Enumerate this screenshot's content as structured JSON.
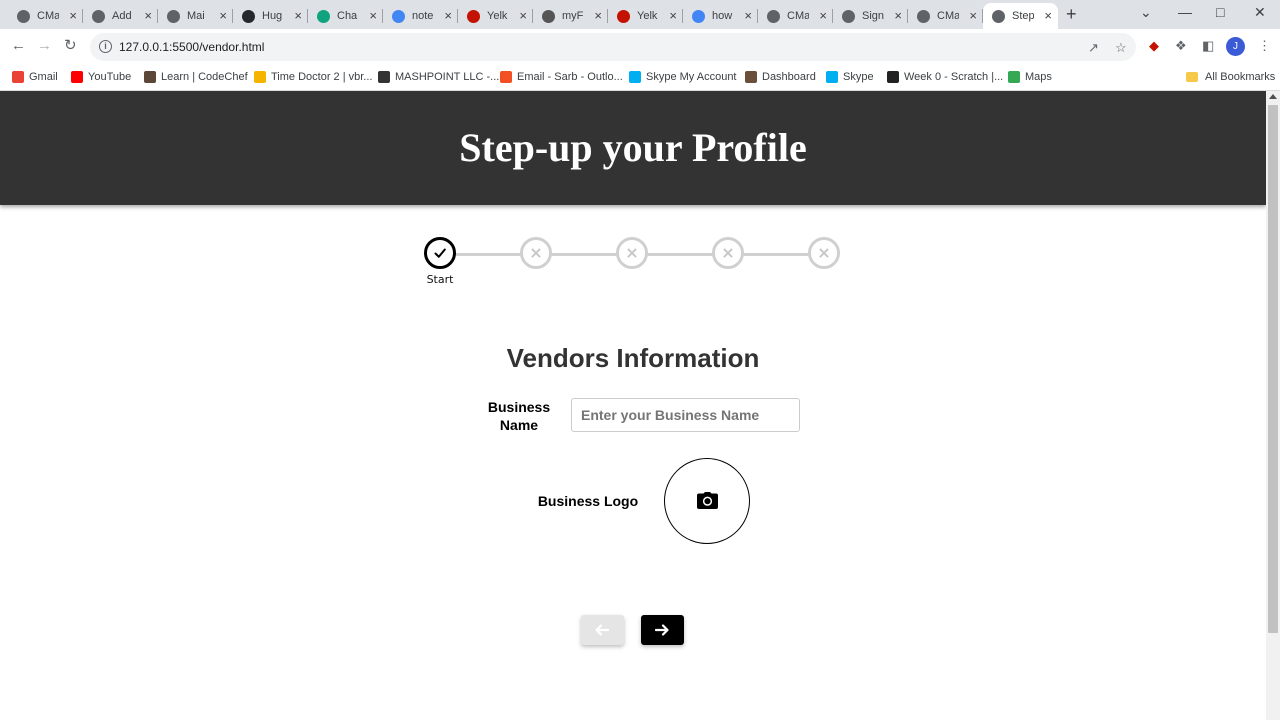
{
  "browser": {
    "tabs": [
      {
        "title": "CMa",
        "favicon": "globe-icon",
        "color": "#5f6368"
      },
      {
        "title": "Add",
        "favicon": "globe-icon",
        "color": "#5f6368"
      },
      {
        "title": "Mai",
        "favicon": "globe-icon",
        "color": "#5f6368"
      },
      {
        "title": "Hug",
        "favicon": "github-icon",
        "color": "#24292e"
      },
      {
        "title": "Cha",
        "favicon": "chatgpt-icon",
        "color": "#10a37f"
      },
      {
        "title": "note",
        "favicon": "google-icon",
        "color": "#4285f4"
      },
      {
        "title": "Yelk",
        "favicon": "yelp-icon",
        "color": "#c41200"
      },
      {
        "title": "myF",
        "favicon": "page-icon",
        "color": "#555555"
      },
      {
        "title": "Yelk",
        "favicon": "yelp-icon",
        "color": "#c41200"
      },
      {
        "title": "how",
        "favicon": "google-icon",
        "color": "#4285f4"
      },
      {
        "title": "CMa",
        "favicon": "globe-icon",
        "color": "#5f6368"
      },
      {
        "title": "Sign",
        "favicon": "globe-icon",
        "color": "#5f6368"
      },
      {
        "title": "CMa",
        "favicon": "globe-icon",
        "color": "#5f6368"
      },
      {
        "title": "Step",
        "favicon": "globe-icon",
        "color": "#5f6368",
        "active": true
      }
    ],
    "url": "127.0.0.1:5500/vendor.html",
    "avatar_letter": "J",
    "bookmarks": [
      {
        "label": "Gmail",
        "icon": "gmail-icon",
        "color": "#ea4335"
      },
      {
        "label": "YouTube",
        "icon": "youtube-icon",
        "color": "#ff0000"
      },
      {
        "label": "Learn | CodeChef",
        "icon": "codechef-icon",
        "color": "#5b4638"
      },
      {
        "label": "Time Doctor 2 | vbr...",
        "icon": "timedoctor-icon",
        "color": "#f4b400"
      },
      {
        "label": "MASHPOINT LLC -...",
        "icon": "mashpoint-icon",
        "color": "#333333"
      },
      {
        "label": "Email - Sarb - Outlo...",
        "icon": "microsoft-icon",
        "color": "#f25022"
      },
      {
        "label": "Skype My Account",
        "icon": "skype-icon",
        "color": "#00aff0"
      },
      {
        "label": "Dashboard",
        "icon": "dashboard-icon",
        "color": "#6b4f3a"
      },
      {
        "label": "Skype",
        "icon": "skype-icon",
        "color": "#00aff0"
      },
      {
        "label": "Week 0 - Scratch |...",
        "icon": "scratch-icon",
        "color": "#222222"
      },
      {
        "label": "Maps",
        "icon": "maps-icon",
        "color": "#34a853"
      }
    ],
    "all_bookmarks": "All Bookmarks"
  },
  "page": {
    "header_title": "Step-up your Profile",
    "stepper": {
      "steps": [
        {
          "status": "done",
          "label": "Start"
        },
        {
          "status": "todo",
          "label": ""
        },
        {
          "status": "todo",
          "label": ""
        },
        {
          "status": "todo",
          "label": ""
        },
        {
          "status": "todo",
          "label": ""
        }
      ]
    },
    "section_title": "Vendors Information",
    "business_name": {
      "label": "Business Name",
      "placeholder": "Enter your Business Name",
      "value": ""
    },
    "business_logo": {
      "label": "Business Logo"
    },
    "colors": {
      "header_bg": "#333333",
      "primary": "#000000",
      "inactive": "#d0d0d0"
    }
  }
}
